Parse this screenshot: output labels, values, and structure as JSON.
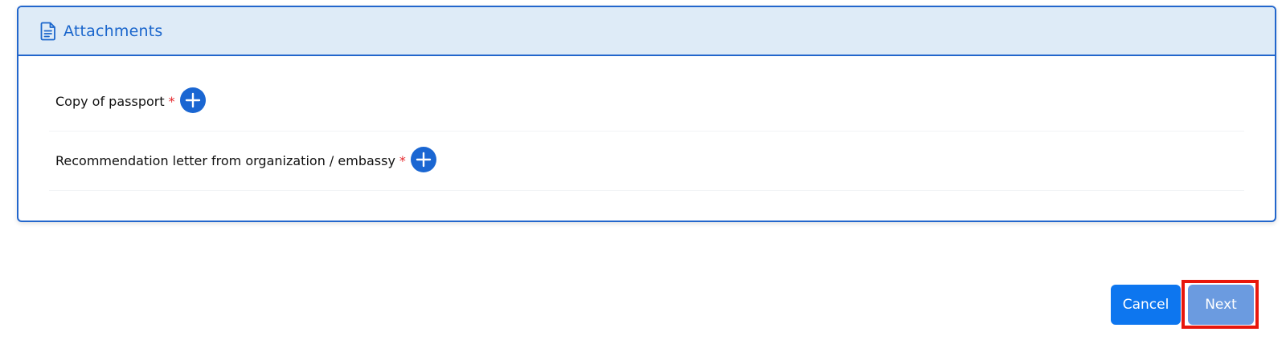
{
  "attachments": {
    "title": "Attachments",
    "icon": "document-icon",
    "items": [
      {
        "label": "Copy of passport",
        "required_mark": "*"
      },
      {
        "label": "Recommendation letter from organization / embassy",
        "required_mark": "*"
      }
    ]
  },
  "actions": {
    "cancel_label": "Cancel",
    "next_label": "Next"
  },
  "colors": {
    "accent": "#1a66d2",
    "header_bg": "#deebf7",
    "required": "#e5252a",
    "cancel_bg": "#0d76ef",
    "next_bg": "#6b9be0",
    "highlight": "#e8170c"
  }
}
